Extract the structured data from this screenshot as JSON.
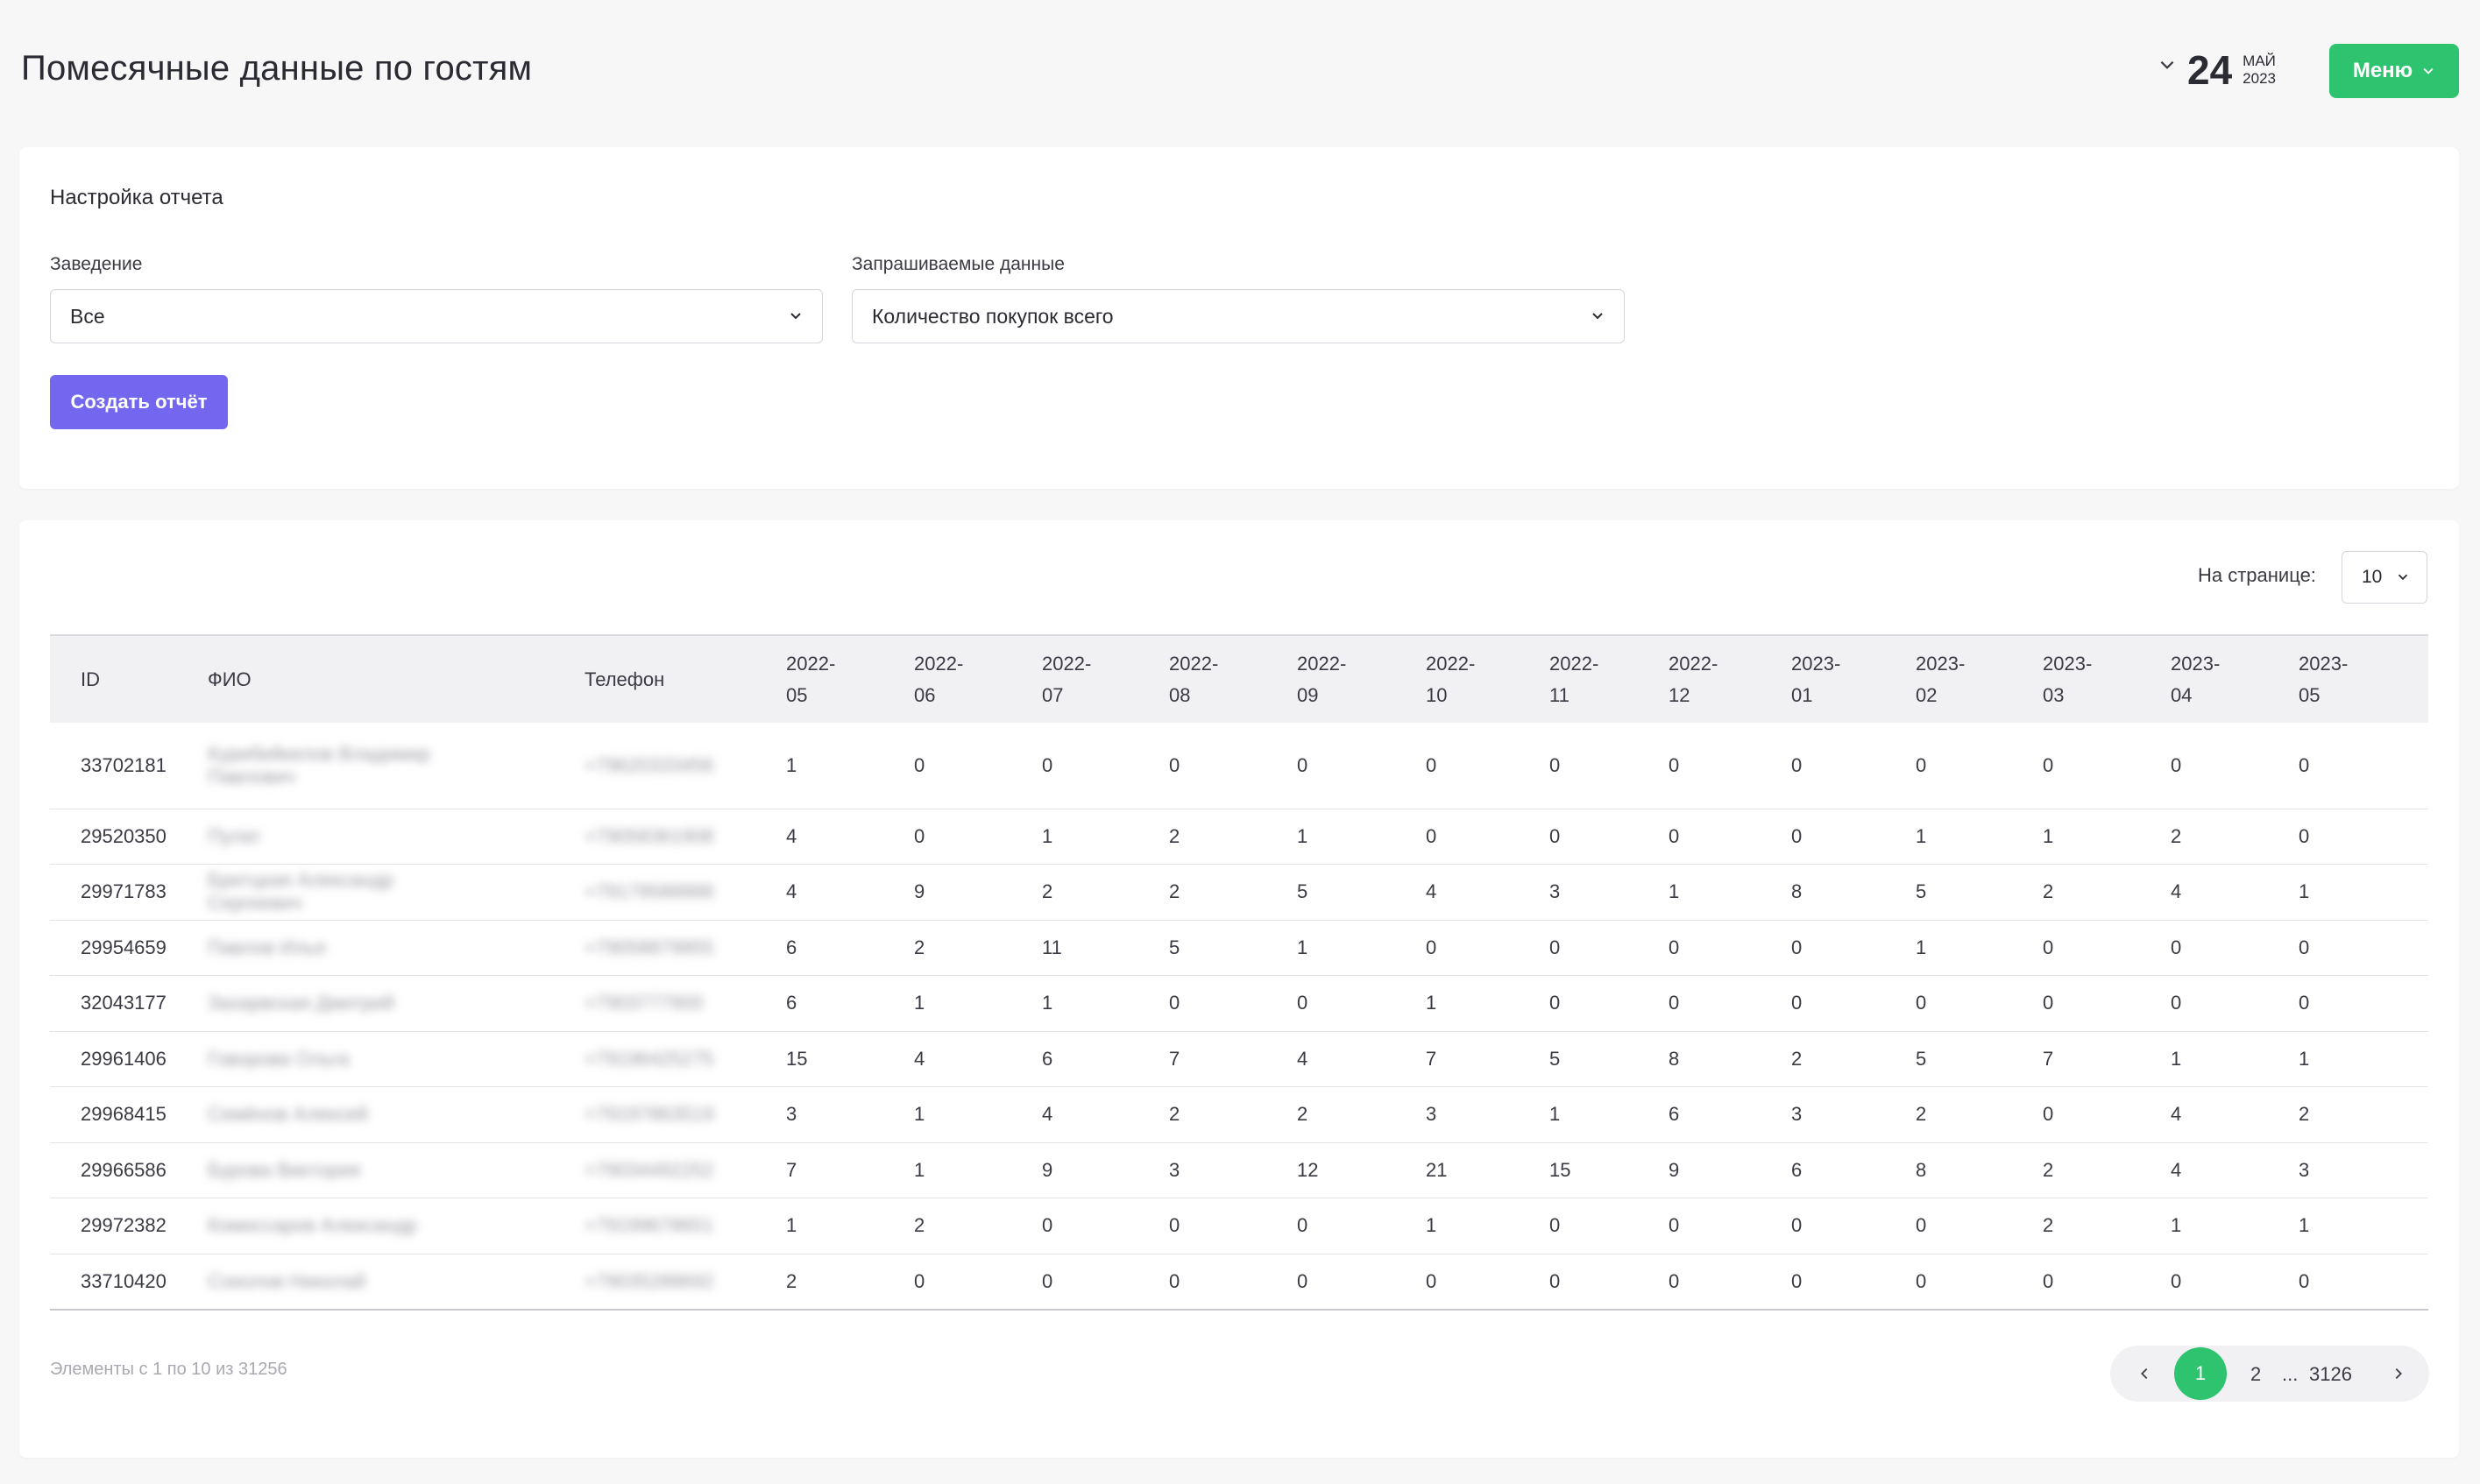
{
  "header": {
    "title": "Помесячные данные по гостям",
    "date_day": "24",
    "date_month": "МАЙ",
    "date_year": "2023",
    "menu_label": "Меню"
  },
  "settings": {
    "title": "Настройка отчета",
    "venue_label": "Заведение",
    "venue_value": "Все",
    "data_label": "Запрашиваемые данные",
    "data_value": "Количество покупок всего",
    "create_label": "Создать отчёт"
  },
  "table_controls": {
    "per_page_label": "На странице:",
    "per_page_value": "10"
  },
  "table": {
    "columns": [
      "ID",
      "ФИО",
      "Телефон",
      "2022-\n05",
      "2022-\n06",
      "2022-\n07",
      "2022-\n08",
      "2022-\n09",
      "2022-\n10",
      "2022-\n11",
      "2022-\n12",
      "2023-\n01",
      "2023-\n02",
      "2023-\n03",
      "2023-\n04",
      "2023-\n05"
    ],
    "rows": [
      {
        "id": "33702181",
        "name": "Курибейкелов Владимир Павлович",
        "phone": "+79620333456",
        "v": [
          "1",
          "0",
          "0",
          "0",
          "0",
          "0",
          "0",
          "0",
          "0",
          "0",
          "0",
          "0",
          "0"
        ]
      },
      {
        "id": "29520350",
        "name": "Пулат",
        "phone": "+79058361908",
        "v": [
          "4",
          "0",
          "1",
          "2",
          "1",
          "0",
          "0",
          "0",
          "0",
          "1",
          "1",
          "2",
          "0"
        ]
      },
      {
        "id": "29971783",
        "name": "Бритцкая Александр Сергеевич",
        "phone": "+79179588888",
        "v": [
          "4",
          "9",
          "2",
          "2",
          "5",
          "4",
          "3",
          "1",
          "8",
          "5",
          "2",
          "4",
          "1"
        ]
      },
      {
        "id": "29954659",
        "name": "Павлов Илья",
        "phone": "+79058879855",
        "v": [
          "6",
          "2",
          "11",
          "5",
          "1",
          "0",
          "0",
          "0",
          "0",
          "1",
          "0",
          "0",
          "0"
        ]
      },
      {
        "id": "32043177",
        "name": "Захарвская Дмитрий",
        "phone": "+7903777900",
        "v": [
          "6",
          "1",
          "1",
          "0",
          "0",
          "1",
          "0",
          "0",
          "0",
          "0",
          "0",
          "0",
          "0"
        ]
      },
      {
        "id": "29961406",
        "name": "Говорова Ольга",
        "phone": "+79196425275",
        "v": [
          "15",
          "4",
          "6",
          "7",
          "4",
          "7",
          "5",
          "8",
          "2",
          "5",
          "7",
          "1",
          "1"
        ]
      },
      {
        "id": "29968415",
        "name": "Семёнов Алексей",
        "phone": "+79197863519",
        "v": [
          "3",
          "1",
          "4",
          "2",
          "2",
          "3",
          "1",
          "6",
          "3",
          "2",
          "0",
          "4",
          "2"
        ]
      },
      {
        "id": "29966586",
        "name": "Бурова Виктория",
        "phone": "+79034492252",
        "v": [
          "7",
          "1",
          "9",
          "3",
          "12",
          "21",
          "15",
          "9",
          "6",
          "8",
          "2",
          "4",
          "3"
        ]
      },
      {
        "id": "29972382",
        "name": "Комиссаров Александр",
        "phone": "+79199678651",
        "v": [
          "1",
          "2",
          "0",
          "0",
          "0",
          "1",
          "0",
          "0",
          "0",
          "0",
          "2",
          "1",
          "1"
        ]
      },
      {
        "id": "33710420",
        "name": "Соколов Николай",
        "phone": "+79035288692",
        "v": [
          "2",
          "0",
          "0",
          "0",
          "0",
          "0",
          "0",
          "0",
          "0",
          "0",
          "0",
          "0",
          "0"
        ]
      }
    ]
  },
  "footer": {
    "info": "Элементы с 1 по 10 из 31256",
    "pages": [
      "1",
      "2",
      "...",
      "3126"
    ]
  },
  "colors": {
    "accent_green": "#2ec46f",
    "accent_purple": "#7367f0"
  }
}
